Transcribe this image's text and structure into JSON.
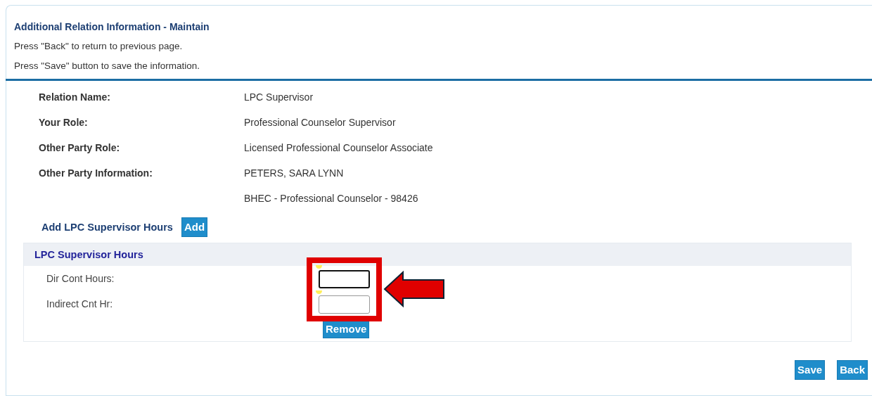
{
  "header": {
    "title": "Additional Relation Information - Maintain",
    "instructions": [
      "Press \"Back\" to return to previous page.",
      "Press \"Save\" button to save the information."
    ]
  },
  "details": [
    {
      "label": "Relation Name:",
      "values": [
        "LPC Supervisor"
      ]
    },
    {
      "label": "Your Role:",
      "values": [
        "Professional Counselor Supervisor"
      ]
    },
    {
      "label": "Other Party Role:",
      "values": [
        "Licensed Professional Counselor Associate"
      ]
    },
    {
      "label": "Other Party Information:",
      "values": [
        "PETERS, SARA LYNN",
        "BHEC - Professional Counselor - 98426"
      ]
    }
  ],
  "add_row": {
    "label": "Add LPC Supervisor Hours",
    "button": "Add"
  },
  "hours_section": {
    "title": "LPC Supervisor Hours",
    "fields": [
      {
        "label": "Dir Cont Hours:",
        "focused": true,
        "required": true
      },
      {
        "label": "Indirect Cnt Hr:",
        "focused": false,
        "required": true
      }
    ],
    "remove_button": "Remove",
    "annotation": {
      "highlight": true,
      "arrow": true
    }
  },
  "buttons": [
    "Save",
    "Back"
  ]
}
